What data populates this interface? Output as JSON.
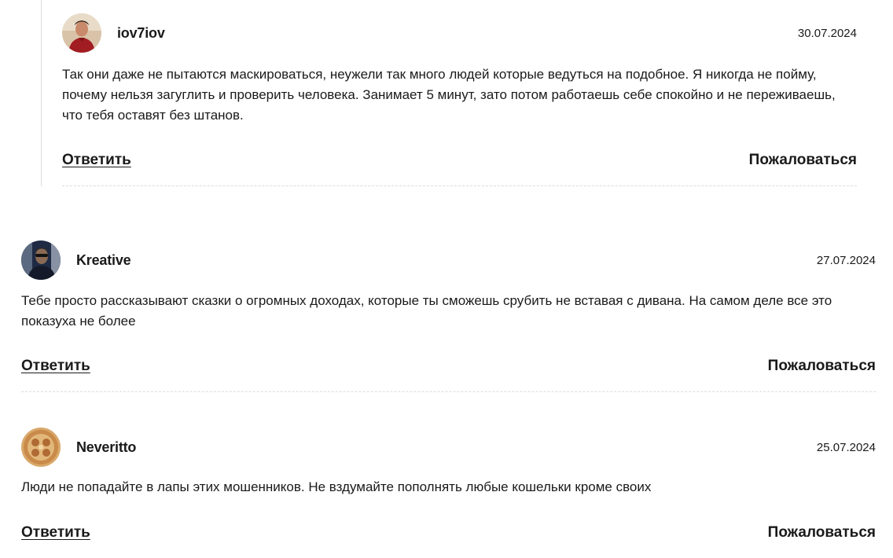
{
  "comments": [
    {
      "username": "iov7iov",
      "date": "30.07.2024",
      "text": "Так они даже не пытаются маскироваться, неужели так много людей которые ведуться на подобное. Я никогда не пойму, почему нельзя загуглить и проверить человека. Занимает 5 минут, зато потом работаешь себе спокойно и не переживаешь, что тебя оставят без штанов.",
      "reply_label": "Ответить",
      "complain_label": "Пожаловаться",
      "avatar_icon": "user-avatar-photo"
    },
    {
      "username": "Kreative",
      "date": "27.07.2024",
      "text": "Тебе просто рассказывают сказки о огромных доходах, которые ты сможешь срубить не вставая с дивана. На самом деле все это показуха не более",
      "reply_label": "Ответить",
      "complain_label": "Пожаловаться",
      "avatar_icon": "user-avatar-photo"
    },
    {
      "username": "Neveritto",
      "date": "25.07.2024",
      "text": "Люди не попадайте в лапы этих мошенников. Не вздумайте пополнять любые кошельки кроме своих",
      "reply_label": "Ответить",
      "complain_label": "Пожаловаться",
      "avatar_icon": "user-avatar-image"
    }
  ],
  "colors": {
    "text": "#1a1a1a",
    "divider": "#dcdcdc",
    "thread_line": "#dddddd"
  }
}
